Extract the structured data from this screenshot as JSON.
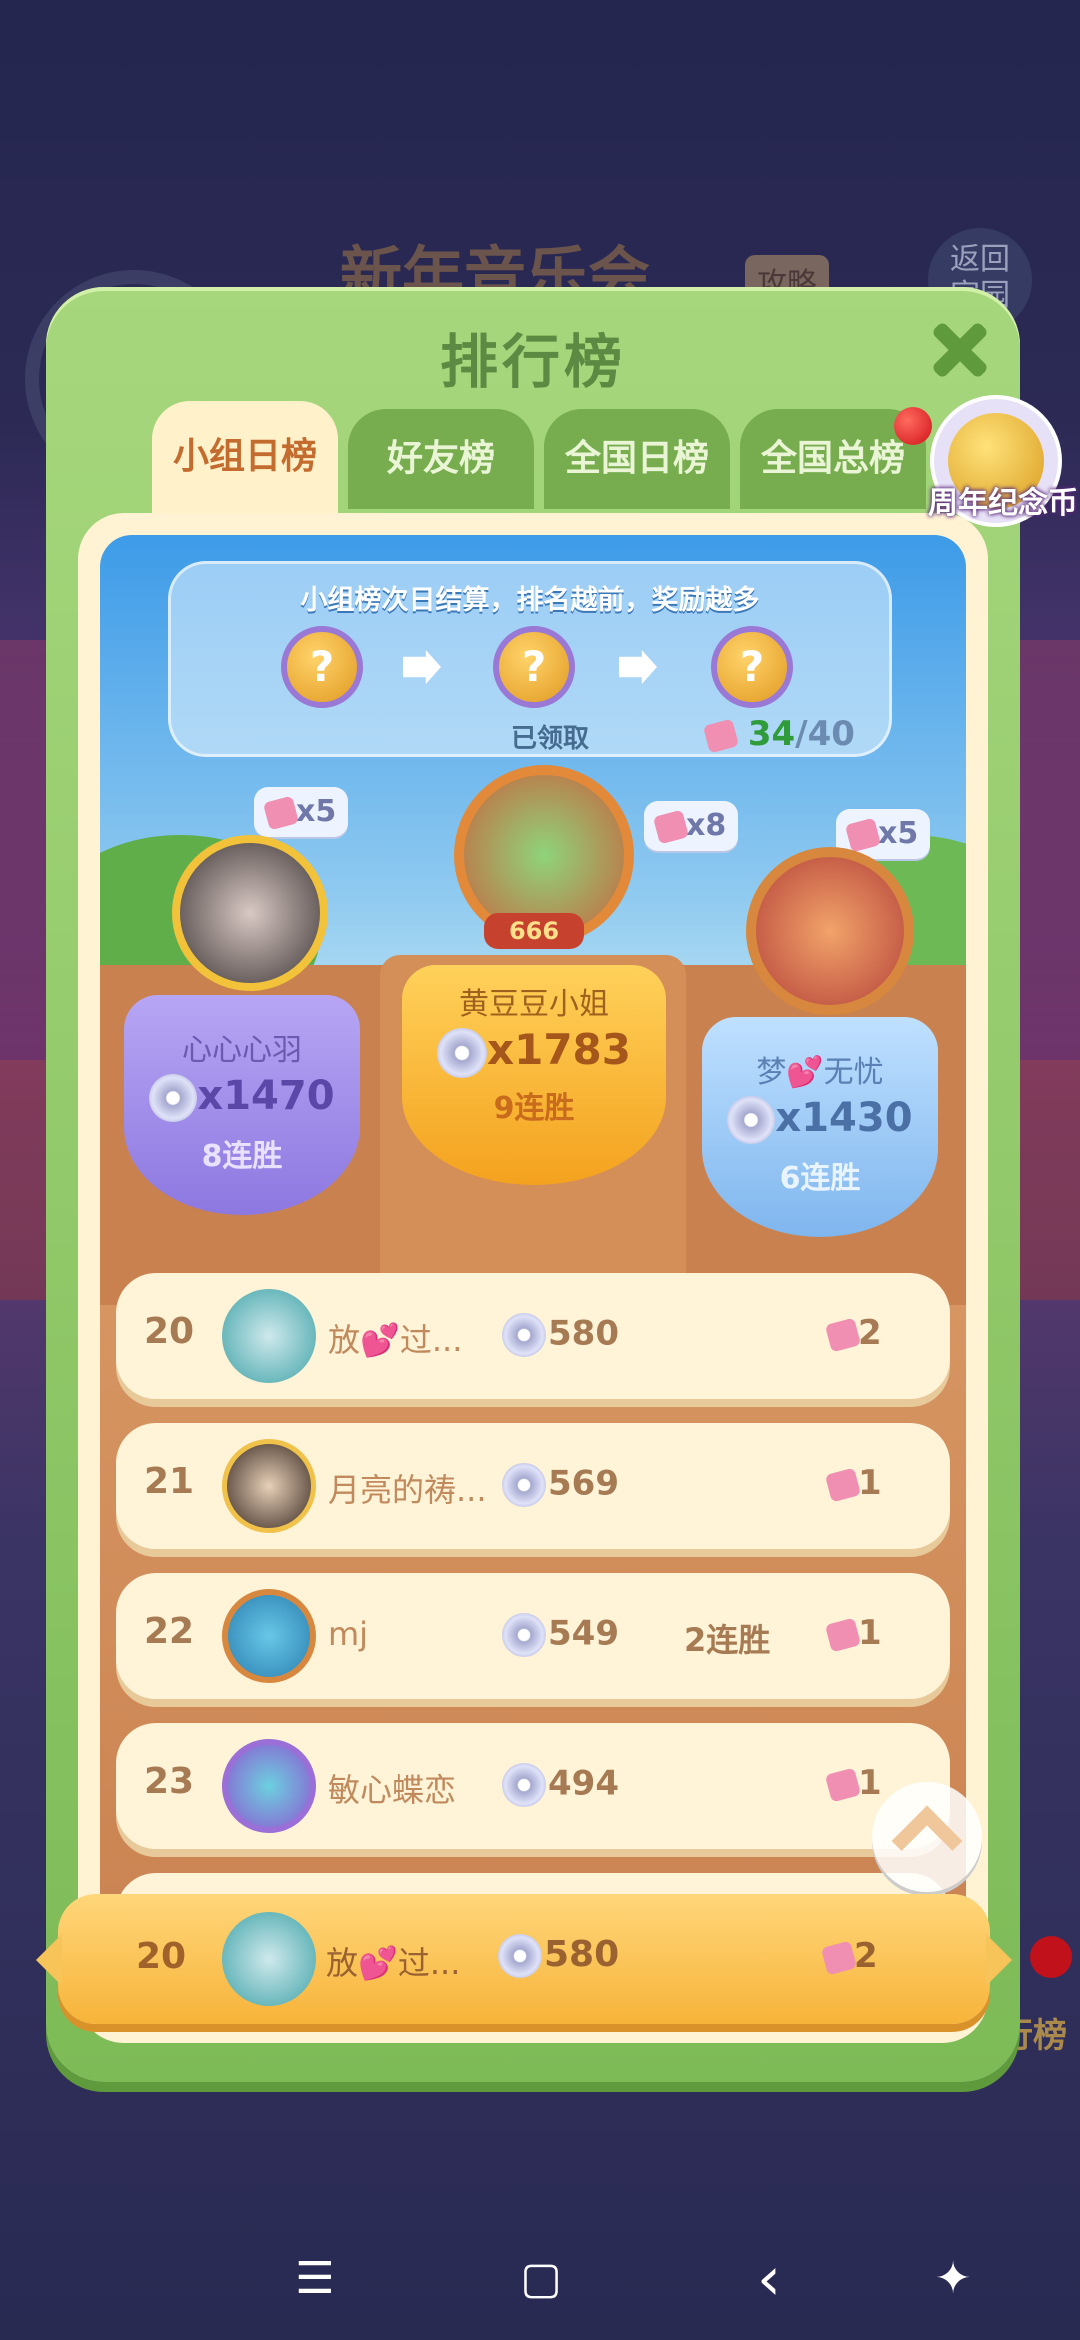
{
  "background": {
    "event_title": "新年音乐会",
    "guide_badge": "攻略",
    "return_label": "返回\n家园",
    "side_label": "排行榜"
  },
  "panel": {
    "title": "排行榜"
  },
  "tabs": [
    {
      "label": "小组日榜",
      "active": true
    },
    {
      "label": "好友榜",
      "active": false
    },
    {
      "label": "全国日榜",
      "active": false
    },
    {
      "label": "全国总榜",
      "active": false
    }
  ],
  "anniversary_coin": {
    "label": "周年纪念币"
  },
  "rewards": {
    "notice": "小组榜次日结算，排名越前，奖励越多",
    "claimed_label": "已领取",
    "progress_current": "34",
    "progress_total": "/40"
  },
  "podium": {
    "first": {
      "name": "黄豆豆小姐",
      "score": "x1783",
      "streak": "9连胜",
      "gift": "x8",
      "avatar_badge": "666"
    },
    "second": {
      "name": "心心心羽",
      "score": "x1470",
      "streak": "8连胜",
      "gift": "x5"
    },
    "third": {
      "name": "梦💕无忧",
      "score": "x1430",
      "streak": "6连胜",
      "gift": "x5"
    }
  },
  "rows": [
    {
      "rank": "20",
      "name": "放💕过...",
      "score": "580",
      "streak": "",
      "gifts": "2"
    },
    {
      "rank": "21",
      "name": "月亮的祷...",
      "score": "569",
      "streak": "",
      "gifts": "1"
    },
    {
      "rank": "22",
      "name": "mj",
      "score": "549",
      "streak": "2连胜",
      "gifts": "1"
    },
    {
      "rank": "23",
      "name": "敏心蝶恋",
      "score": "494",
      "streak": "",
      "gifts": "1"
    }
  ],
  "me": {
    "rank": "20",
    "name": "放💕过...",
    "score": "580",
    "gifts": "2"
  },
  "navbar": {
    "menu_icon": "☰",
    "home_icon": "▢",
    "back_icon": "‹",
    "accessibility_icon": "✦"
  }
}
